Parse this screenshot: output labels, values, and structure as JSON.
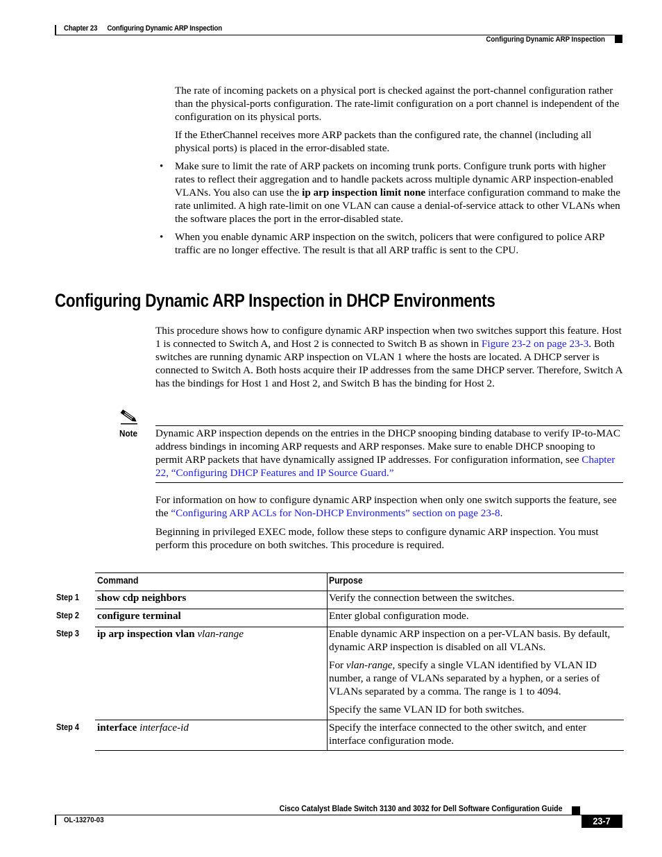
{
  "header": {
    "chapter_number": "Chapter 23",
    "chapter_title": "Configuring Dynamic ARP Inspection",
    "section_title": "Configuring Dynamic ARP Inspection"
  },
  "intro": {
    "paragraphs": [
      "The rate of incoming packets on a physical port is checked against the port-channel configuration rather than the physical-ports configuration. The rate-limit configuration on a port channel is independent of the configuration on its physical ports.",
      "If the EtherChannel receives more ARP packets than the configured rate, the channel (including all physical ports) is placed in the error-disabled state."
    ],
    "bullets": [
      {
        "before": "Make sure to limit the rate of ARP packets on incoming trunk ports. Configure trunk ports with higher rates to reflect their aggregation and to handle packets across multiple dynamic ARP inspection-enabled VLANs. You also can use the ",
        "bold": "ip arp inspection limit none",
        "after": " interface configuration command to make the rate unlimited. A high rate-limit on one VLAN can cause a denial-of-service attack to other VLANs when the software places the port in the error-disabled state."
      },
      {
        "text": "When you enable dynamic ARP inspection on the switch, policers that were configured to police ARP traffic are no longer effective. The result is that all ARP traffic is sent to the CPU."
      }
    ]
  },
  "section": {
    "heading": "Configuring Dynamic ARP Inspection in DHCP Environments",
    "para1": {
      "before": "This procedure shows how to configure dynamic ARP inspection when two switches support this feature. Host 1 is connected to Switch A, and Host 2 is connected to Switch B as shown in ",
      "link": "Figure 23-2 on page 23-3",
      "after": ". Both switches are running dynamic ARP inspection on VLAN 1 where the hosts are located. A DHCP server is connected to Switch A. Both hosts acquire their IP addresses from the same DHCP server. Therefore, Switch A has the bindings for Host 1 and Host 2, and Switch B has the binding for Host 2."
    },
    "note": {
      "label": "Note",
      "before": "Dynamic ARP inspection depends on the entries in the DHCP snooping binding database to verify IP-to-MAC address bindings in incoming ARP requests and ARP responses. Make sure to enable DHCP snooping to permit ARP packets that have dynamically assigned IP addresses. For configuration information, see ",
      "link": "Chapter 22, “Configuring DHCP Features and IP Source Guard.”",
      "after": ""
    },
    "para2": {
      "before": "For information on how to configure dynamic ARP inspection when only one switch supports the feature, see the ",
      "link": "“Configuring ARP ACLs for Non-DHCP Environments” section on page 23-8",
      "after": "."
    },
    "para3": "Beginning in privileged EXEC mode, follow these steps to configure dynamic ARP inspection. You must perform this procedure on both switches. This procedure is required."
  },
  "table": {
    "headers": {
      "command": "Command",
      "purpose": "Purpose"
    },
    "rows": [
      {
        "step": "Step 1",
        "cmd_bold": "show cdp neighbors",
        "cmd_italic": "",
        "purpose": [
          "Verify the connection between the switches."
        ]
      },
      {
        "step": "Step 2",
        "cmd_bold": "configure terminal",
        "cmd_italic": "",
        "purpose": [
          "Enter global configuration mode."
        ]
      },
      {
        "step": "Step 3",
        "cmd_bold": "ip arp inspection vlan",
        "cmd_italic": "vlan-range",
        "purpose": [
          "Enable dynamic ARP inspection on a per-VLAN basis. By default, dynamic ARP inspection is disabled on all VLANs.",
          "For ",
          "Specify the same VLAN ID for both switches."
        ],
        "purpose_2_italic": "vlan-range",
        "purpose_2_after": ", specify a single VLAN identified by VLAN ID number, a range of VLANs separated by a hyphen, or a series of VLANs separated by a comma. The range is 1 to 4094."
      },
      {
        "step": "Step 4",
        "cmd_bold": "interface",
        "cmd_italic": "interface-id",
        "purpose": [
          "Specify the interface connected to the other switch, and enter interface configuration mode."
        ]
      }
    ]
  },
  "footer": {
    "guide_title": "Cisco Catalyst Blade Switch 3130 and 3032 for Dell Software Configuration Guide",
    "doc_number": "OL-13270-03",
    "page_number": "23-7"
  },
  "colors": {
    "link": "#1a1aff",
    "text": "#000000"
  }
}
